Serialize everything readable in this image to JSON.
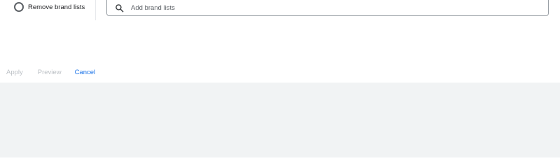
{
  "brand_list_option": {
    "label": "Remove brand lists"
  },
  "search": {
    "placeholder": "Add brand lists",
    "value": ""
  },
  "actions": {
    "apply_label": "Apply",
    "preview_label": "Preview",
    "cancel_label": "Cancel"
  },
  "icons": {
    "radio": "radio-unchecked-icon",
    "search": "search-icon"
  },
  "colors": {
    "accent": "#1a73e8",
    "disabled_text": "#bdc1c6",
    "background_gray": "#f1f3f4"
  }
}
